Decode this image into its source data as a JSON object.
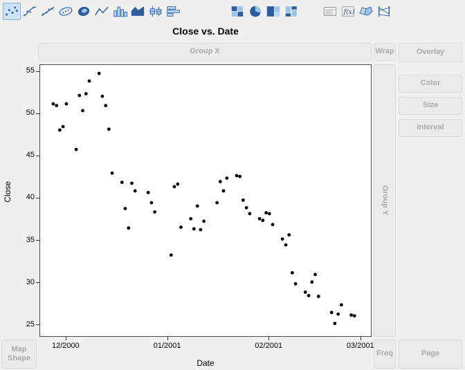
{
  "title": "Close vs. Date",
  "toolbar": {
    "groups": [
      {
        "items": [
          {
            "name": "points",
            "selected": true
          },
          {
            "name": "smoother",
            "selected": false
          },
          {
            "name": "line-of-fit",
            "selected": false
          },
          {
            "name": "ellipse",
            "selected": false
          },
          {
            "name": "contour",
            "selected": false
          },
          {
            "name": "line",
            "selected": false
          },
          {
            "name": "bar",
            "selected": false
          },
          {
            "name": "area",
            "selected": false
          },
          {
            "name": "box-plot",
            "selected": false
          },
          {
            "name": "histogram",
            "selected": false
          }
        ]
      },
      {
        "items": [
          {
            "name": "heatmap",
            "selected": false
          },
          {
            "name": "pie",
            "selected": false
          },
          {
            "name": "treemap",
            "selected": false
          },
          {
            "name": "mosaic",
            "selected": false
          }
        ]
      },
      {
        "items": [
          {
            "name": "caption-box",
            "selected": false
          },
          {
            "name": "formula",
            "selected": false
          },
          {
            "name": "map-shapes",
            "selected": false
          },
          {
            "name": "parallel-plot",
            "selected": false
          }
        ]
      }
    ]
  },
  "drop_zones": {
    "group_x": "Group X",
    "wrap": "Wrap",
    "overlay": "Overlay",
    "color": "Color",
    "size": "Size",
    "interval": "Interval",
    "group_y": "Group Y",
    "map_shape": "Map Shape",
    "freq": "Freq",
    "page": "Page"
  },
  "colors": {
    "accent_blue": "#3465a4",
    "icon_fill_light": "#bdd7ee",
    "icon_fill_mid": "#9dc3e6",
    "icon_fill_dark": "#2e5c9a",
    "selected_tool_bg": "#cfe3f8",
    "zone_bg": "#ebebeb",
    "zone_text": "#a9a9a9",
    "marker": "#000000",
    "window_bg": "#f0f0f0",
    "plot_bg": "#ffffff"
  },
  "chart_data": {
    "type": "scatter",
    "title": "Close vs. Date",
    "xlabel": "Date",
    "ylabel": "Close",
    "x_domain": [
      "11/23/2000",
      "03/04/2001"
    ],
    "y_domain": [
      23.7,
      55.8
    ],
    "x_ticks": [
      {
        "label": "12/2000",
        "date": "12/01/2000"
      },
      {
        "label": "01/2001",
        "date": "01/01/2001"
      },
      {
        "label": "02/2001",
        "date": "02/01/2001"
      },
      {
        "label": "03/2001",
        "date": "03/01/2001"
      }
    ],
    "y_ticks": [
      25,
      30,
      35,
      40,
      45,
      50,
      55
    ],
    "grid": false,
    "legend": "none",
    "marker": {
      "shape": "circle",
      "radius": 2.4,
      "color": "#000000"
    },
    "points": [
      {
        "date": "11/27/2000",
        "close": 51.2
      },
      {
        "date": "11/28/2000",
        "close": 51.0
      },
      {
        "date": "11/29/2000",
        "close": 48.1
      },
      {
        "date": "11/30/2000",
        "close": 48.5
      },
      {
        "date": "12/01/2000",
        "close": 51.2
      },
      {
        "date": "12/04/2000",
        "close": 45.8
      },
      {
        "date": "12/05/2000",
        "close": 52.2
      },
      {
        "date": "12/06/2000",
        "close": 50.4
      },
      {
        "date": "12/07/2000",
        "close": 52.4
      },
      {
        "date": "12/08/2000",
        "close": 53.9
      },
      {
        "date": "12/11/2000",
        "close": 54.8
      },
      {
        "date": "12/12/2000",
        "close": 52.1
      },
      {
        "date": "12/13/2000",
        "close": 51.0
      },
      {
        "date": "12/14/2000",
        "close": 48.2
      },
      {
        "date": "12/15/2000",
        "close": 43.0
      },
      {
        "date": "12/18/2000",
        "close": 41.9
      },
      {
        "date": "12/19/2000",
        "close": 38.8
      },
      {
        "date": "12/20/2000",
        "close": 36.5
      },
      {
        "date": "12/21/2000",
        "close": 41.8
      },
      {
        "date": "12/22/2000",
        "close": 40.9
      },
      {
        "date": "12/26/2000",
        "close": 40.7
      },
      {
        "date": "12/27/2000",
        "close": 39.5
      },
      {
        "date": "12/28/2000",
        "close": 38.4
      },
      {
        "date": "01/02/2001",
        "close": 33.3
      },
      {
        "date": "01/03/2001",
        "close": 41.4
      },
      {
        "date": "01/04/2001",
        "close": 41.7
      },
      {
        "date": "01/05/2001",
        "close": 36.6
      },
      {
        "date": "01/08/2001",
        "close": 37.6
      },
      {
        "date": "01/09/2001",
        "close": 36.4
      },
      {
        "date": "01/10/2001",
        "close": 39.1
      },
      {
        "date": "01/11/2001",
        "close": 36.3
      },
      {
        "date": "01/12/2001",
        "close": 37.3
      },
      {
        "date": "01/16/2001",
        "close": 39.5
      },
      {
        "date": "01/17/2001",
        "close": 42.0
      },
      {
        "date": "01/18/2001",
        "close": 40.9
      },
      {
        "date": "01/19/2001",
        "close": 42.4
      },
      {
        "date": "01/22/2001",
        "close": 42.7
      },
      {
        "date": "01/23/2001",
        "close": 42.6
      },
      {
        "date": "01/24/2001",
        "close": 39.8
      },
      {
        "date": "01/25/2001",
        "close": 38.9
      },
      {
        "date": "01/26/2001",
        "close": 38.2
      },
      {
        "date": "01/29/2001",
        "close": 37.6
      },
      {
        "date": "01/30/2001",
        "close": 37.4
      },
      {
        "date": "01/31/2001",
        "close": 38.3
      },
      {
        "date": "02/01/2001",
        "close": 38.2
      },
      {
        "date": "02/02/2001",
        "close": 36.9
      },
      {
        "date": "02/05/2001",
        "close": 35.2
      },
      {
        "date": "02/06/2001",
        "close": 34.5
      },
      {
        "date": "02/07/2001",
        "close": 35.7
      },
      {
        "date": "02/08/2001",
        "close": 31.2
      },
      {
        "date": "02/09/2001",
        "close": 29.9
      },
      {
        "date": "02/12/2001",
        "close": 28.9
      },
      {
        "date": "02/13/2001",
        "close": 28.5
      },
      {
        "date": "02/14/2001",
        "close": 30.1
      },
      {
        "date": "02/15/2001",
        "close": 31.0
      },
      {
        "date": "02/16/2001",
        "close": 28.4
      },
      {
        "date": "02/20/2001",
        "close": 26.5
      },
      {
        "date": "02/21/2001",
        "close": 25.2
      },
      {
        "date": "02/22/2001",
        "close": 26.3
      },
      {
        "date": "02/23/2001",
        "close": 27.4
      },
      {
        "date": "02/26/2001",
        "close": 26.2
      },
      {
        "date": "02/27/2001",
        "close": 26.1
      }
    ]
  }
}
